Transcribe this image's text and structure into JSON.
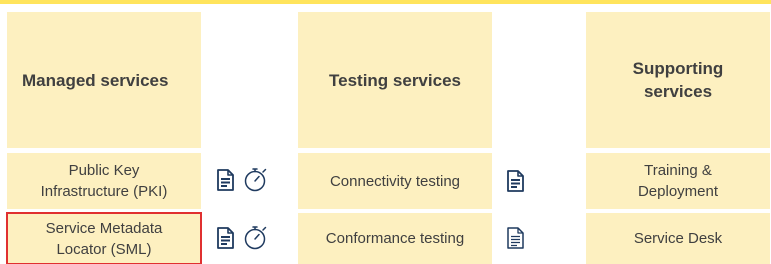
{
  "columns": [
    {
      "header": "Managed services",
      "items": [
        {
          "label": "Public Key Infrastructure (PKI)",
          "icons": [
            "document-icon",
            "stopwatch-icon"
          ]
        },
        {
          "label": "Service Metadata Locator (SML)",
          "icons": [
            "document-icon",
            "stopwatch-icon"
          ],
          "selected": true
        }
      ]
    },
    {
      "header": "Testing services",
      "items": [
        {
          "label": "Connectivity testing",
          "icons": [
            "document-icon"
          ]
        },
        {
          "label": "Conformance testing",
          "icons": [
            "document-icon"
          ]
        }
      ]
    },
    {
      "header": "Supporting services",
      "items": [
        {
          "label": "Training & Deployment"
        },
        {
          "label": "Service Desk"
        }
      ]
    }
  ],
  "colors": {
    "accent_bar": "#ffe45c",
    "cell_background": "#fdf0c0",
    "selection_border": "#e03030",
    "text": "#404040",
    "icon_stroke": "#1f3a5f"
  }
}
